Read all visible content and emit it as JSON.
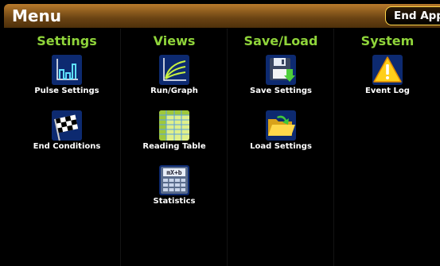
{
  "header": {
    "title": "Menu",
    "end_app_label": "End App"
  },
  "columns": [
    {
      "title": "Settings",
      "items": [
        {
          "label": "Pulse Settings",
          "icon": "pulse-chart-icon"
        },
        {
          "label": "End Conditions",
          "icon": "checkered-flag-icon"
        }
      ]
    },
    {
      "title": "Views",
      "items": [
        {
          "label": "Run/Graph",
          "icon": "graph-curves-icon"
        },
        {
          "label": "Reading Table",
          "icon": "table-grid-icon"
        },
        {
          "label": "Statistics",
          "icon": "calculator-icon"
        }
      ]
    },
    {
      "title": "Save/Load",
      "items": [
        {
          "label": "Save Settings",
          "icon": "floppy-save-icon"
        },
        {
          "label": "Load Settings",
          "icon": "folder-load-icon"
        }
      ]
    },
    {
      "title": "System",
      "items": [
        {
          "label": "Event Log",
          "icon": "warning-triangle-icon"
        }
      ]
    }
  ],
  "colors": {
    "section_title": "#8fd43a",
    "header_bar": "#8a5a1d",
    "end_app_border": "#ffd64a"
  }
}
